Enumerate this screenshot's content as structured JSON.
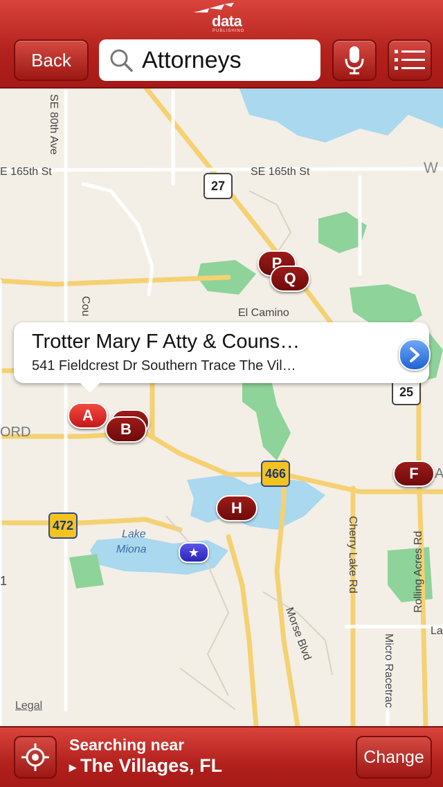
{
  "header": {
    "logo_word": "data",
    "logo_sub": "PUBLISHING",
    "back_label": "Back",
    "search_value": "Attorneys"
  },
  "map": {
    "road_labels": {
      "se80": "SE 80th Ave",
      "se165_left": "E 165th St",
      "se165_right": "SE 165th St",
      "el_camino": "El Camino",
      "cou": "Cou",
      "ord": "ORD",
      "w": "W",
      "cherry": "Cherry Lake Rd",
      "rolling": "Rolling Acres Rd",
      "morse": "Morse Blvd",
      "micro": "Micro Racetrac",
      "la": "La",
      "a": "A",
      "one": "1",
      "lake": "Lake",
      "miona": "Miona"
    },
    "shields": {
      "us27": "27",
      "r25": "25",
      "r466": "466",
      "r472": "472"
    },
    "pins": [
      "A",
      "B",
      "F",
      "H",
      "P",
      "Q"
    ],
    "legal": "Legal"
  },
  "callout": {
    "title": "Trotter Mary F Atty & Couns…",
    "address": "541 Fieldcrest Dr Southern Trace The Vil…"
  },
  "footer": {
    "searching_near": "Searching near",
    "location": "The Villages, FL",
    "change_label": "Change"
  },
  "colors": {
    "brand_red": "#b3211d",
    "water": "#a9d8ef",
    "park": "#8ed39a",
    "road": "#f5d173"
  }
}
